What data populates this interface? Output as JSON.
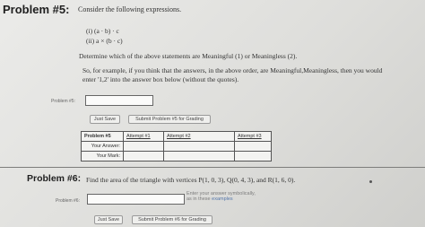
{
  "problem5": {
    "title": "Problem #5:",
    "intro": "Consider the following expressions.",
    "expressions": [
      "(i) (a · b) · c",
      "(ii) a × (b · c)"
    ],
    "instruction": "Determine which of the above statements are Meaningful (1) or Meaningless (2).",
    "example_line1": "So, for example, if you think that the answers, in the above order, are Meaningful,Meaningless, then you would",
    "example_line2": "enter '1,2' into the answer box below (without the quotes).",
    "answer_label": "Problem #5:",
    "answer_value": "",
    "just_save": "Just Save",
    "submit": "Submit Problem #5 for Grading",
    "history": {
      "header": "Problem #5",
      "attempts": [
        "Attempt #1",
        "Attempt #2",
        "Attempt #3"
      ],
      "row_labels": [
        "Your Answer:",
        "Your Mark:"
      ]
    }
  },
  "problem6": {
    "title": "Problem #6:",
    "text": "Find the area of the triangle with vertices P(1, 0, 3), Q(0, 4, 3), and R(1, 6, 0).",
    "answer_label": "Problem #6:",
    "answer_value": "",
    "hint_line1": "Enter your answer symbolically,",
    "hint_line2_prefix": "as in these",
    "hint_link": "examples",
    "just_save": "Just Save",
    "submit": "Submit Problem #6 for Grading"
  }
}
